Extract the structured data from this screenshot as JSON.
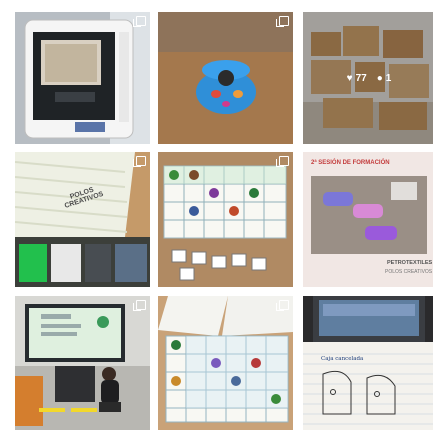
{
  "posts": [
    {
      "id": "post-3d-printer"
    },
    {
      "id": "post-blue-3d-object"
    },
    {
      "id": "post-boxes",
      "likes": "77",
      "comments": "1"
    },
    {
      "id": "post-fan-polos",
      "fan_text": "POLOS CREATIVOS"
    },
    {
      "id": "post-grid-game"
    },
    {
      "id": "post-training-session",
      "headline": "2ª SESIÓN DE FORMACIÓN",
      "brand": "PETROTEXTILES",
      "subbrand": "POLOS CREATIVOS"
    },
    {
      "id": "post-classroom-screen"
    },
    {
      "id": "post-grid-cards"
    },
    {
      "id": "post-laptop-notebook",
      "notebook_text": "Caja cancelada"
    }
  ]
}
